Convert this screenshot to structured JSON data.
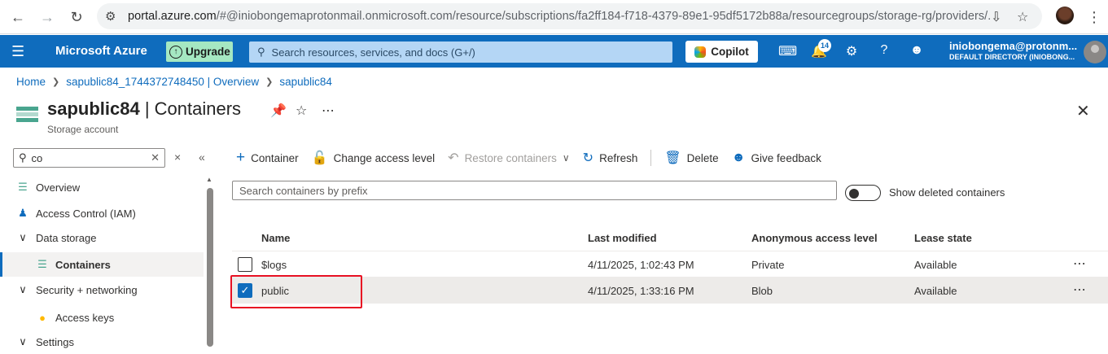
{
  "browser": {
    "url_host": "portal.azure.com",
    "url_rest": "/#@iniobongemaprotonmail.onmicrosoft.com/resource/subscriptions/fa2ff184-f718-4379-89e1-95df5172b88a/resourcegroups/storage-rg/providers/..."
  },
  "azure_header": {
    "brand": "Microsoft Azure",
    "upgrade_label": "Upgrade",
    "search_placeholder": "Search resources, services, and docs (G+/)",
    "copilot_label": "Copilot",
    "notification_count": "14",
    "account_name": "iniobongema@protonm...",
    "account_directory": "DEFAULT DIRECTORY (INIOBONG..."
  },
  "breadcrumb": [
    "Home",
    "sapublic84_1744372748450 | Overview",
    "sapublic84"
  ],
  "page": {
    "title_resource": "sapublic84",
    "title_section": " | Containers",
    "subtitle": "Storage account"
  },
  "sidebar": {
    "search_value": "co",
    "items": [
      {
        "label": "Overview",
        "icon": "storage-icon"
      },
      {
        "label": "Access Control (IAM)",
        "icon": "people-icon"
      },
      {
        "label": "Data storage",
        "icon": "chevron-down-icon"
      },
      {
        "label": "Containers",
        "icon": "storage-icon"
      },
      {
        "label": "Security + networking",
        "icon": "chevron-down-icon"
      },
      {
        "label": "Access keys",
        "icon": "key-icon"
      },
      {
        "label": "Settings",
        "icon": "chevron-down-icon"
      }
    ]
  },
  "toolbar": {
    "container": "Container",
    "change_access": "Change access level",
    "restore": "Restore containers",
    "refresh": "Refresh",
    "delete": "Delete",
    "feedback": "Give feedback"
  },
  "filter": {
    "placeholder": "Search containers by prefix",
    "toggle_label": "Show deleted containers"
  },
  "table": {
    "columns": [
      "Name",
      "Last modified",
      "Anonymous access level",
      "Lease state"
    ],
    "rows": [
      {
        "name": "$logs",
        "modified": "4/11/2025, 1:02:43 PM",
        "access": "Private",
        "lease": "Available",
        "checked": false
      },
      {
        "name": "public",
        "modified": "4/11/2025, 1:33:16 PM",
        "access": "Blob",
        "lease": "Available",
        "checked": true
      }
    ]
  },
  "colors": {
    "azure_blue": "#0f6cbd",
    "highlight_red": "#e81123"
  }
}
